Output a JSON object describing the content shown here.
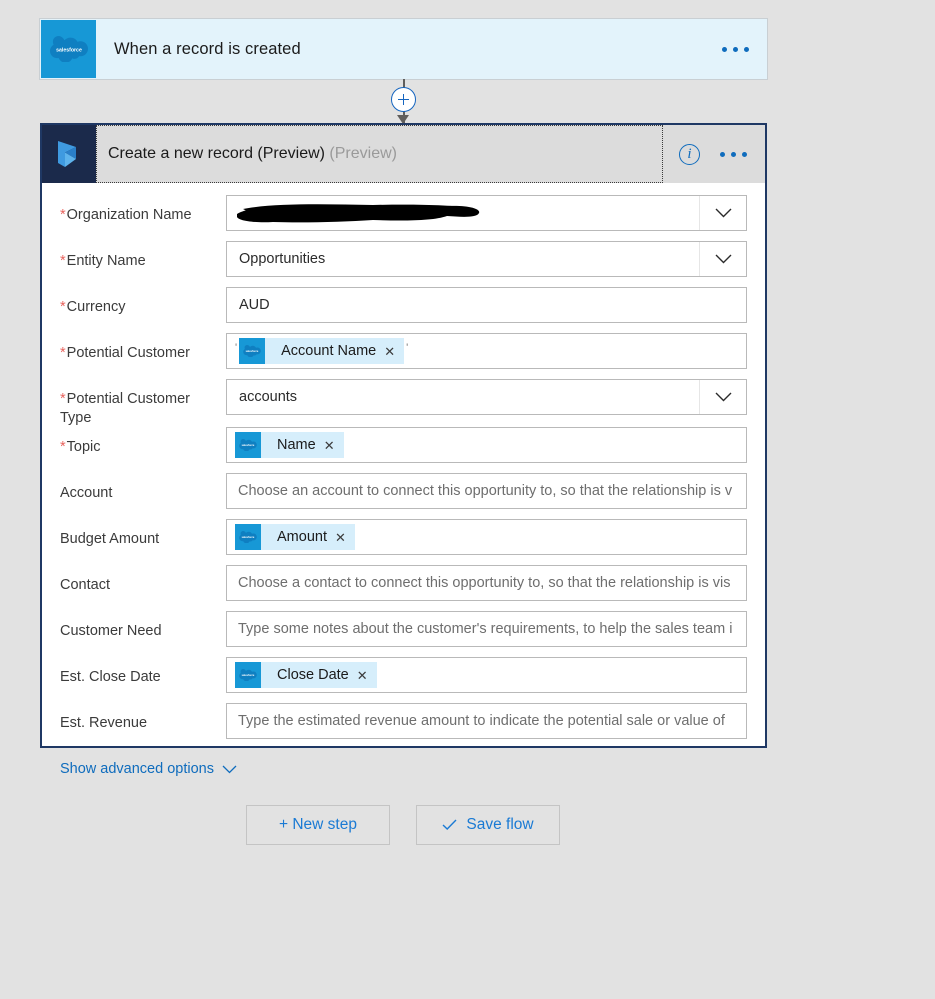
{
  "trigger": {
    "icon": "salesforce-icon",
    "title": "When a record is created",
    "menu_icon": "ellipsis-icon"
  },
  "connector": {
    "add_icon": "plus-circle-icon",
    "arrow_icon": "arrow-down-icon"
  },
  "action": {
    "icon": "dynamics365-icon",
    "title": "Create a new record (Preview)",
    "title_suffix": "(Preview)",
    "info_icon": "info-icon",
    "info_glyph": "i",
    "menu_icon": "ellipsis-icon",
    "advanced_label": "Show advanced options",
    "advanced_icon": "chevron-down-icon",
    "fields": [
      {
        "label": "Organization Name",
        "required": true,
        "type": "dropdown-redacted",
        "value": "",
        "dropdown_icon": "chevron-down-icon"
      },
      {
        "label": "Entity Name",
        "required": true,
        "type": "dropdown",
        "value": "Opportunities",
        "dropdown_icon": "chevron-down-icon"
      },
      {
        "label": "Currency",
        "required": true,
        "type": "text",
        "value": "AUD"
      },
      {
        "label": "Potential Customer",
        "required": true,
        "type": "token",
        "token": "Account Name",
        "token_icon": "salesforce-icon",
        "remove_icon": "close-icon",
        "lead_mark": "'",
        "trail_mark": "'"
      },
      {
        "label": "Potential Customer Type",
        "required": true,
        "type": "dropdown",
        "value": "accounts",
        "dropdown_icon": "chevron-down-icon"
      },
      {
        "label": "Topic",
        "required": true,
        "type": "token",
        "token": "Name",
        "token_icon": "salesforce-icon",
        "remove_icon": "close-icon"
      },
      {
        "label": "Account",
        "required": false,
        "type": "placeholder",
        "placeholder": "Choose an account to connect this opportunity to, so that the relationship is v"
      },
      {
        "label": "Budget Amount",
        "required": false,
        "type": "token",
        "token": "Amount",
        "token_icon": "salesforce-icon",
        "remove_icon": "close-icon"
      },
      {
        "label": "Contact",
        "required": false,
        "type": "placeholder",
        "placeholder": "Choose a contact to connect this opportunity to, so that the relationship is vis"
      },
      {
        "label": "Customer Need",
        "required": false,
        "type": "placeholder",
        "placeholder": "Type some notes about the customer's requirements, to help the sales team i"
      },
      {
        "label": "Est. Close Date",
        "required": false,
        "type": "token",
        "token": "Close Date",
        "token_icon": "salesforce-icon",
        "remove_icon": "close-icon"
      },
      {
        "label": "Est. Revenue",
        "required": false,
        "type": "placeholder",
        "placeholder": "Type the estimated revenue amount to indicate the potential sale or value of"
      }
    ]
  },
  "footer": {
    "new_step_label": "+ New step",
    "save_flow_label": "Save flow",
    "save_icon": "check-icon",
    "new_step_icon": "plus-icon"
  },
  "colors": {
    "page_bg": "#e2e2e2",
    "trigger_bg": "#e3f3fb",
    "salesforce_blue": "#1798d6",
    "dynamics_navy": "#1b2a4b",
    "accent_blue": "#0f6cbd",
    "card_border": "#1f3864",
    "required_red": "#e8635d",
    "chip_bg": "#d6eefb"
  }
}
